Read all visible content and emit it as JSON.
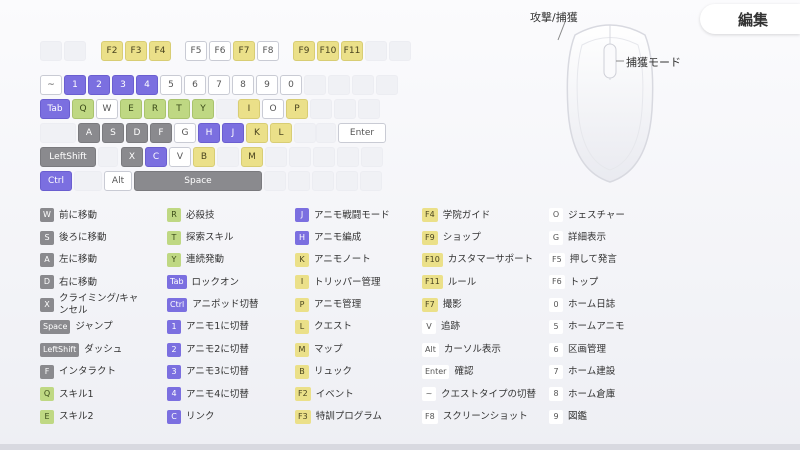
{
  "edit_button": "編集",
  "mouse": {
    "attack_capture": "攻撃/捕獲",
    "capture_mode": "捕獲モード"
  },
  "colors": {
    "yellow": "#ebe089",
    "purple": "#7b6fe0",
    "green": "#bfd883",
    "gray": "#8a8a8e",
    "white": "#ffffff"
  },
  "keyboard": {
    "fn_row": [
      "F2",
      "F3",
      "F4",
      "F5",
      "F6",
      "F7",
      "F8",
      "F9",
      "F10",
      "F11"
    ],
    "num_row": [
      "~",
      "1",
      "2",
      "3",
      "4",
      "5",
      "6",
      "7",
      "8",
      "9",
      "0"
    ],
    "q_row": [
      "Tab",
      "Q",
      "W",
      "E",
      "R",
      "T",
      "Y",
      "I",
      "O",
      "P"
    ],
    "a_row": [
      "A",
      "S",
      "D",
      "F",
      "G",
      "H",
      "J",
      "K",
      "L",
      "Enter"
    ],
    "z_row": [
      "LeftShift",
      "X",
      "C",
      "V",
      "B",
      "M"
    ],
    "bottom_row": [
      "Ctrl",
      "Alt",
      "Space"
    ]
  },
  "legend": [
    [
      {
        "key": "W",
        "label": "前に移動",
        "color": "gray"
      },
      {
        "key": "S",
        "label": "後ろに移動",
        "color": "gray"
      },
      {
        "key": "A",
        "label": "左に移動",
        "color": "gray"
      },
      {
        "key": "D",
        "label": "右に移動",
        "color": "gray"
      },
      {
        "key": "X",
        "label": "クライミング/キャンセル",
        "color": "gray",
        "wrap": true
      },
      {
        "key": "Space",
        "label": "ジャンプ",
        "color": "gray"
      },
      {
        "key": "LeftShift",
        "label": "ダッシュ",
        "color": "gray"
      },
      {
        "key": "F",
        "label": "インタラクト",
        "color": "gray"
      },
      {
        "key": "Q",
        "label": "スキル1",
        "color": "green"
      },
      {
        "key": "E",
        "label": "スキル2",
        "color": "green"
      }
    ],
    [
      {
        "key": "R",
        "label": "必殺技",
        "color": "green"
      },
      {
        "key": "T",
        "label": "探索スキル",
        "color": "green"
      },
      {
        "key": "Y",
        "label": "連続発動",
        "color": "green"
      },
      {
        "key": "Tab",
        "label": "ロックオン",
        "color": "purple"
      },
      {
        "key": "Ctrl",
        "label": "アニポッド切替",
        "color": "purple"
      },
      {
        "key": "1",
        "label": "アニモ1に切替",
        "color": "purple"
      },
      {
        "key": "2",
        "label": "アニモ2に切替",
        "color": "purple"
      },
      {
        "key": "3",
        "label": "アニモ3に切替",
        "color": "purple"
      },
      {
        "key": "4",
        "label": "アニモ4に切替",
        "color": "purple"
      },
      {
        "key": "C",
        "label": "リンク",
        "color": "purple"
      }
    ],
    [
      {
        "key": "J",
        "label": "アニモ戦闘モード",
        "color": "purple"
      },
      {
        "key": "H",
        "label": "アニモ編成",
        "color": "purple"
      },
      {
        "key": "K",
        "label": "アニモノート",
        "color": "yellow"
      },
      {
        "key": "I",
        "label": "トリッパー管理",
        "color": "yellow"
      },
      {
        "key": "P",
        "label": "アニモ管理",
        "color": "yellow"
      },
      {
        "key": "L",
        "label": "クエスト",
        "color": "yellow"
      },
      {
        "key": "M",
        "label": "マップ",
        "color": "yellow"
      },
      {
        "key": "B",
        "label": "リュック",
        "color": "yellow"
      },
      {
        "key": "F2",
        "label": "イベント",
        "color": "yellow"
      },
      {
        "key": "F3",
        "label": "特訓プログラム",
        "color": "yellow"
      }
    ],
    [
      {
        "key": "F4",
        "label": "学院ガイド",
        "color": "yellow"
      },
      {
        "key": "F9",
        "label": "ショップ",
        "color": "yellow"
      },
      {
        "key": "F10",
        "label": "カスタマーサポート",
        "color": "yellow"
      },
      {
        "key": "F11",
        "label": "ルール",
        "color": "yellow"
      },
      {
        "key": "F7",
        "label": "撮影",
        "color": "yellow"
      },
      {
        "key": "V",
        "label": "追跡",
        "color": "white"
      },
      {
        "key": "Alt",
        "label": "カーソル表示",
        "color": "white"
      },
      {
        "key": "Enter",
        "label": "確認",
        "color": "white"
      },
      {
        "key": "~",
        "label": "クエストタイプの切替",
        "color": "white"
      },
      {
        "key": "F8",
        "label": "スクリーンショット",
        "color": "white"
      }
    ],
    [
      {
        "key": "O",
        "label": "ジェスチャー",
        "color": "white"
      },
      {
        "key": "G",
        "label": "詳細表示",
        "color": "white"
      },
      {
        "key": "F5",
        "label": "押して発言",
        "color": "white"
      },
      {
        "key": "F6",
        "label": "トップ",
        "color": "white"
      },
      {
        "key": "0",
        "label": "ホーム日誌",
        "color": "white"
      },
      {
        "key": "5",
        "label": "ホームアニモ",
        "color": "white"
      },
      {
        "key": "6",
        "label": "区画管理",
        "color": "white"
      },
      {
        "key": "7",
        "label": "ホーム建設",
        "color": "white"
      },
      {
        "key": "8",
        "label": "ホーム倉庫",
        "color": "white"
      },
      {
        "key": "9",
        "label": "図鑑",
        "color": "white"
      }
    ]
  ]
}
